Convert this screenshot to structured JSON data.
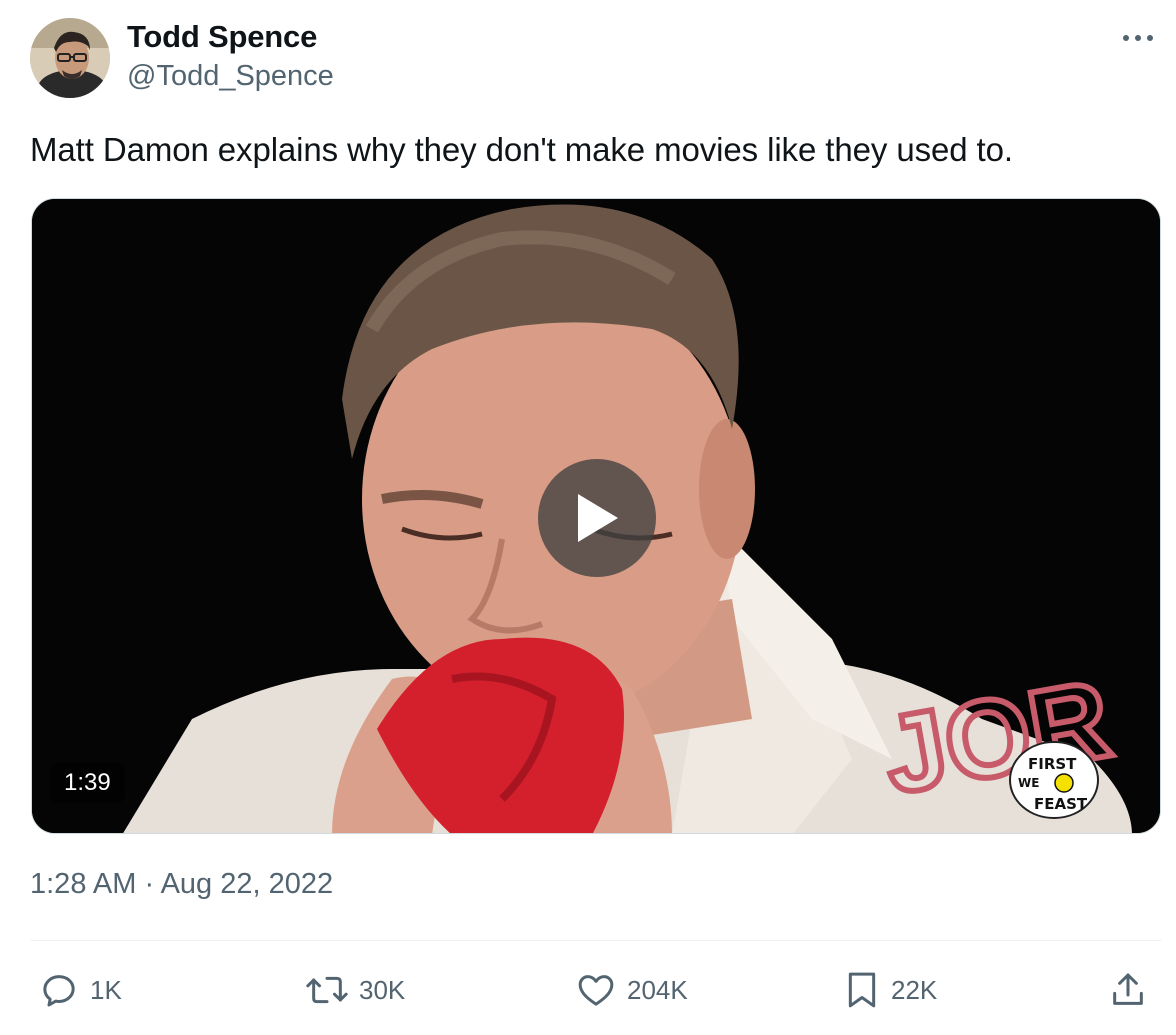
{
  "author": {
    "name": "Todd Spence",
    "handle": "@Todd_Spence",
    "avatar_icon": "avatar-photo"
  },
  "tweet": {
    "text": "Matt Damon explains why they don't make movies like they used to."
  },
  "media": {
    "duration": "1:39",
    "play_icon": "play-icon",
    "watermark_icon": "first-we-feast-logo",
    "watermark_text": "FIRST WE FEAST",
    "shirt_text": "JOR"
  },
  "meta": {
    "timestamp": "1:28 AM · Aug 22, 2022"
  },
  "actions": {
    "reply": {
      "icon": "reply-icon",
      "count": "1K"
    },
    "retweet": {
      "icon": "retweet-icon",
      "count": "30K"
    },
    "like": {
      "icon": "heart-icon",
      "count": "204K"
    },
    "bookmark": {
      "icon": "bookmark-icon",
      "count": "22K"
    },
    "share": {
      "icon": "share-icon"
    }
  },
  "colors": {
    "text_primary": "#0f1419",
    "text_secondary": "#536471",
    "divider": "#eff3f4"
  }
}
